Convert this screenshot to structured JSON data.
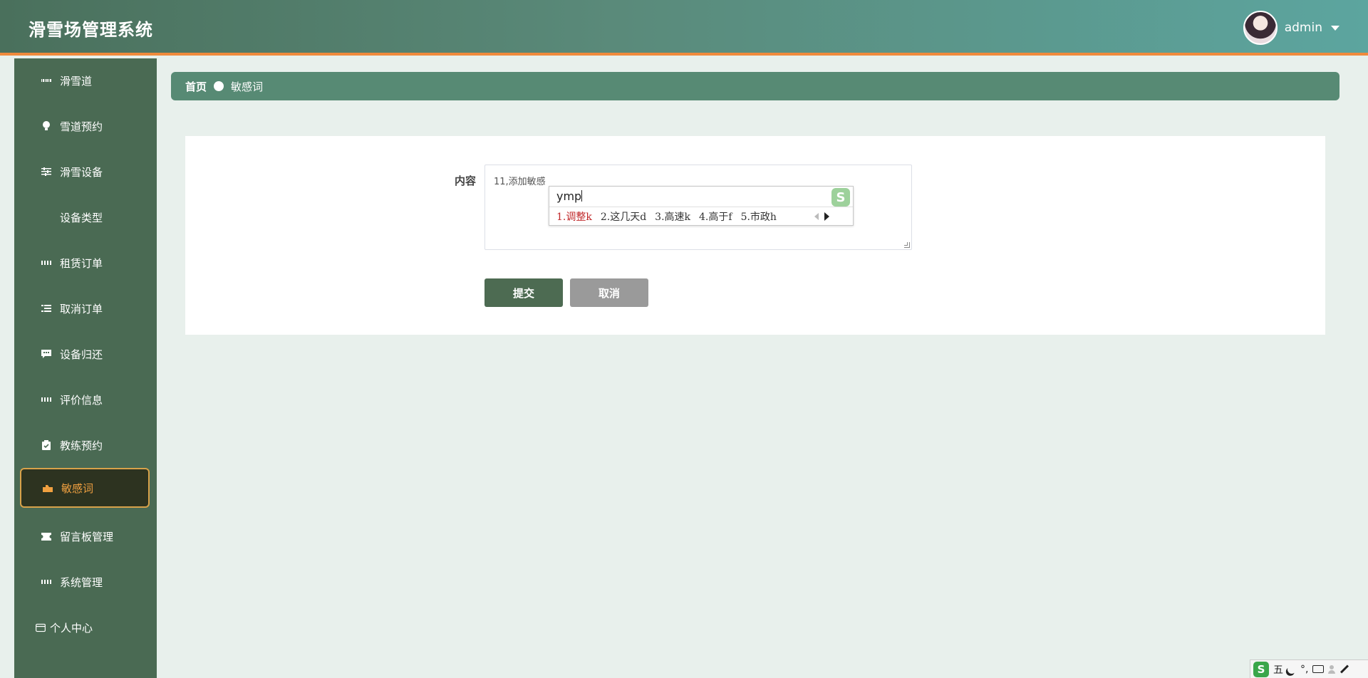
{
  "header": {
    "app_title": "滑雪场管理系统",
    "username": "admin"
  },
  "sidebar": {
    "items": [
      {
        "label": "滑雪道",
        "icon": "grid9-icon"
      },
      {
        "label": "雪道预约",
        "icon": "lightbulb-icon"
      },
      {
        "label": "滑雪设备",
        "icon": "sliders-icon"
      },
      {
        "label": "设备类型",
        "icon": "list-icon"
      },
      {
        "label": "租赁订单",
        "icon": "grid-icon"
      },
      {
        "label": "取消订单",
        "icon": "list-indent-icon"
      },
      {
        "label": "设备归还",
        "icon": "chat-icon"
      },
      {
        "label": "评价信息",
        "icon": "grid-icon"
      },
      {
        "label": "教练预约",
        "icon": "clipboard-check-icon"
      },
      {
        "label": "敏感词",
        "icon": "cart-icon",
        "active": true
      },
      {
        "label": "留言板管理",
        "icon": "ticket-icon"
      },
      {
        "label": "系统管理",
        "icon": "grid-icon"
      },
      {
        "label": "个人中心",
        "icon": "card-icon"
      }
    ],
    "active_color": "#f0a040"
  },
  "breadcrumb": {
    "home": "首页",
    "current": "敏感词"
  },
  "form": {
    "content_label": "内容",
    "content_value": "11,添加敏感",
    "submit_label": "提交",
    "cancel_label": "取消"
  },
  "ime": {
    "input": "ymp",
    "candidates": [
      "1.调整k",
      "2.这几天d",
      "3.高速k",
      "4.高于f",
      "5.市政h"
    ],
    "logo": "S"
  },
  "ime_bar": {
    "logo": "S",
    "mode": "五",
    "punct": "°,"
  },
  "colors": {
    "header_start": "#4a705c",
    "header_end": "#5ca59f",
    "accent_orange": "#f08a3c",
    "sidebar_bg": "#4a6a53",
    "submit_bg": "#4d6b52",
    "cancel_bg": "#9a9a9a"
  }
}
